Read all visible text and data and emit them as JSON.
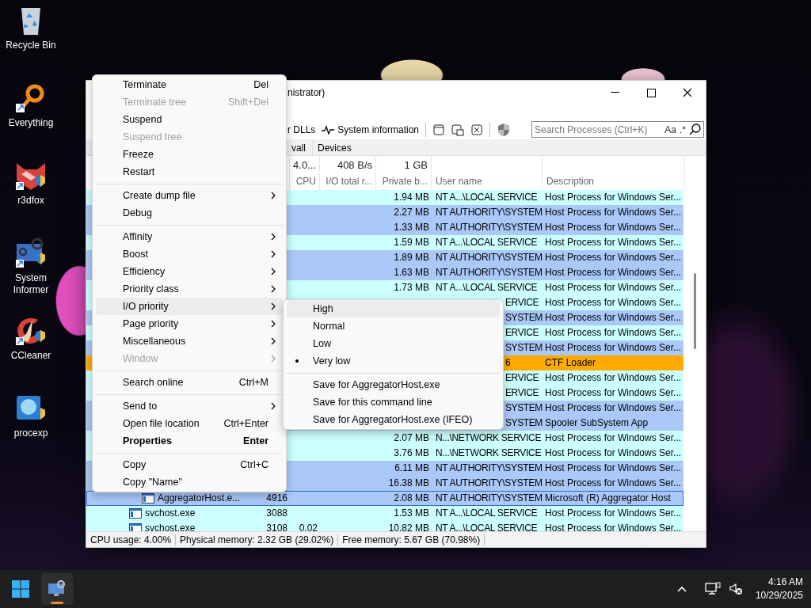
{
  "desktop_icons": [
    {
      "label": "Recycle Bin",
      "kind": "recycle"
    },
    {
      "label": "Everything",
      "kind": "search"
    },
    {
      "label": "r3dfox",
      "kind": "fox"
    },
    {
      "label": "System Informer",
      "kind": "informer"
    },
    {
      "label": "CCleaner",
      "kind": "cleaner"
    },
    {
      "label": "procexp",
      "kind": "procexp"
    }
  ],
  "window": {
    "title": "nistrator)"
  },
  "toolbar": {
    "items": [
      {
        "label": "r DLLs",
        "kind": "text"
      },
      {
        "label": "System information",
        "kind": "pulse"
      }
    ],
    "search": {
      "placeholder": "Search Processes (Ctrl+K)",
      "case_button": "Aa",
      "regex_button": ".*"
    }
  },
  "tabs": [
    {
      "label": "vall",
      "selected": false
    },
    {
      "label": "Devices",
      "selected": false
    }
  ],
  "table": {
    "totals": {
      "cpu": "4.0...",
      "io": "408 B/s",
      "private": "1 GB"
    },
    "columns": [
      "CPU",
      "I/O total r...",
      "Private b...",
      "User name",
      "Description"
    ],
    "rows": [
      {
        "private": "1.94 MB",
        "user": "NT A...\\LOCAL SERVICE",
        "covered": false,
        "description": "Host Process for Windows Ser...",
        "color": "#ccffff",
        "selected": false
      },
      {
        "private": "2.27 MB",
        "user": "NT AUTHORITY\\SYSTEM",
        "covered": false,
        "description": "Host Process for Windows Ser...",
        "color": "#aac8f8",
        "selected": false
      },
      {
        "private": "1.33 MB",
        "user": "NT AUTHORITY\\SYSTEM",
        "covered": false,
        "description": "Host Process for Windows Ser...",
        "color": "#aac8f8",
        "selected": false
      },
      {
        "private": "1.59 MB",
        "user": "NT A...\\LOCAL SERVICE",
        "covered": false,
        "description": "Host Process for Windows Ser...",
        "color": "#ccffff",
        "selected": false
      },
      {
        "private": "1.89 MB",
        "user": "NT AUTHORITY\\SYSTEM",
        "covered": false,
        "description": "Host Process for Windows Ser...",
        "color": "#aac8f8",
        "selected": false
      },
      {
        "private": "1.63 MB",
        "user": "NT AUTHORITY\\SYSTEM",
        "covered": false,
        "description": "Host Process for Windows Ser...",
        "color": "#aac8f8",
        "selected": false
      },
      {
        "private": "1.73 MB",
        "user": "NT A...\\LOCAL SERVICE",
        "covered": false,
        "description": "Host Process for Windows Ser...",
        "color": "#ccffff",
        "selected": false
      },
      {
        "user": "ERVICE",
        "covered": true,
        "description": "Host Process for Windows Ser...",
        "color": "#ccffff",
        "selected": false
      },
      {
        "user": "SYSTEM",
        "covered": true,
        "description": "Host Process for Windows Ser...",
        "color": "#aac8f8",
        "selected": false
      },
      {
        "user": "ERVICE",
        "covered": true,
        "description": "Host Process for Windows Ser...",
        "color": "#ccffff",
        "selected": false
      },
      {
        "user": "SYSTEM",
        "covered": true,
        "description": "Host Process for Windows Ser...",
        "color": "#aac8f8",
        "selected": false
      },
      {
        "user": "6",
        "covered": true,
        "description": "CTF Loader",
        "color": "#ffaa00",
        "selected": false
      },
      {
        "user": "ERVICE",
        "covered": true,
        "description": "Host Process for Windows Ser...",
        "color": "#ccffff",
        "selected": false
      },
      {
        "user": "ERVICE",
        "covered": true,
        "description": "Host Process for Windows Ser...",
        "color": "#ccffff",
        "selected": false
      },
      {
        "user": "SYSTEM",
        "covered": true,
        "description": "Host Process for Windows Ser...",
        "color": "#aac8f8",
        "selected": false
      },
      {
        "user": "SYSTEM",
        "covered": true,
        "description": "Spooler SubSystem App",
        "color": "#aac8f8",
        "selected": false
      },
      {
        "private": "2.07 MB",
        "user": "N...\\NETWORK SERVICE",
        "covered": false,
        "description": "Host Process for Windows Ser...",
        "color": "#ccffff",
        "selected": false
      },
      {
        "private": "3.76 MB",
        "user": "N...\\NETWORK SERVICE",
        "covered": false,
        "description": "Host Process for Windows Ser...",
        "color": "#ccffff",
        "selected": false
      },
      {
        "private": "6.11 MB",
        "user": "NT AUTHORITY\\SYSTEM",
        "covered": false,
        "description": "Host Process for Windows Ser...",
        "color": "#aac8f8",
        "selected": false
      },
      {
        "private": "16.38 MB",
        "user": "NT AUTHORITY\\SYSTEM",
        "covered": false,
        "description": "Host Process for Windows Ser...",
        "color": "#aac8f8",
        "selected": false,
        "children": [
          {
            "name": "AggregatorHost.e...",
            "pid": "4916",
            "private": "2.08 MB",
            "user": "NT AUTHORITY\\SYSTEM",
            "covered": false,
            "description": "Microsoft (R) Aggregator Host",
            "color": "#aac8f8",
            "selected": true
          }
        ]
      },
      {
        "name": "svchost.exe",
        "pid": "3088",
        "private": "1.53 MB",
        "user": "NT A...\\LOCAL SERVICE",
        "covered": false,
        "description": "Host Process for Windows Ser...",
        "color": "#ccffff",
        "selected": false
      },
      {
        "name": "svchost.exe",
        "pid": "3108",
        "cpu": "0.02",
        "private": "10.82 MB",
        "user": "NT A...\\LOCAL SERVICE",
        "covered": false,
        "description": "Host Process for Windows Ser...",
        "color": "#ccffff",
        "selected": false
      }
    ]
  },
  "status_bar": [
    "CPU usage: 4.00%",
    "Physical memory: 2.32 GB (29.02%)",
    "Free memory: 5.67 GB (70.98%)"
  ],
  "context_menu": [
    {
      "kind": "item",
      "label": "Terminate",
      "shortcut": "Del",
      "disabled": false,
      "highlighted": false,
      "bold": false,
      "submenu": false
    },
    {
      "kind": "item",
      "label": "Terminate tree",
      "shortcut": "Shift+Del",
      "disabled": true,
      "highlighted": false,
      "bold": false,
      "submenu": false
    },
    {
      "kind": "item",
      "label": "Suspend",
      "disabled": false,
      "highlighted": false,
      "bold": false,
      "submenu": false
    },
    {
      "kind": "item",
      "label": "Suspend tree",
      "disabled": true,
      "highlighted": false,
      "bold": false,
      "submenu": false
    },
    {
      "kind": "item",
      "label": "Freeze",
      "disabled": false,
      "highlighted": false,
      "bold": false,
      "submenu": false
    },
    {
      "kind": "item",
      "label": "Restart",
      "disabled": false,
      "highlighted": false,
      "bold": false,
      "submenu": false
    },
    {
      "kind": "separator"
    },
    {
      "kind": "item",
      "label": "Create dump file",
      "disabled": false,
      "highlighted": false,
      "bold": false,
      "submenu": true
    },
    {
      "kind": "item",
      "label": "Debug",
      "disabled": false,
      "highlighted": false,
      "bold": false,
      "submenu": false
    },
    {
      "kind": "separator"
    },
    {
      "kind": "item",
      "label": "Affinity",
      "disabled": false,
      "highlighted": false,
      "bold": false,
      "submenu": true
    },
    {
      "kind": "item",
      "label": "Boost",
      "disabled": false,
      "highlighted": false,
      "bold": false,
      "submenu": true
    },
    {
      "kind": "item",
      "label": "Efficiency",
      "disabled": false,
      "highlighted": false,
      "bold": false,
      "submenu": true
    },
    {
      "kind": "item",
      "label": "Priority class",
      "disabled": false,
      "highlighted": false,
      "bold": false,
      "submenu": true
    },
    {
      "kind": "item",
      "label": "I/O priority",
      "disabled": false,
      "highlighted": true,
      "bold": false,
      "submenu": true
    },
    {
      "kind": "item",
      "label": "Page priority",
      "disabled": false,
      "highlighted": false,
      "bold": false,
      "submenu": true
    },
    {
      "kind": "item",
      "label": "Miscellaneous",
      "disabled": false,
      "highlighted": false,
      "bold": false,
      "submenu": true
    },
    {
      "kind": "item",
      "label": "Window",
      "disabled": true,
      "highlighted": false,
      "bold": false,
      "submenu": true
    },
    {
      "kind": "separator"
    },
    {
      "kind": "item",
      "label": "Search online",
      "shortcut": "Ctrl+M",
      "disabled": false,
      "highlighted": false,
      "bold": false,
      "submenu": false
    },
    {
      "kind": "separator"
    },
    {
      "kind": "item",
      "label": "Send to",
      "disabled": false,
      "highlighted": false,
      "bold": false,
      "submenu": true
    },
    {
      "kind": "item",
      "label": "Open file location",
      "shortcut": "Ctrl+Enter",
      "disabled": false,
      "highlighted": false,
      "bold": false,
      "submenu": false
    },
    {
      "kind": "item",
      "label": "Properties",
      "shortcut": "Enter",
      "disabled": false,
      "highlighted": false,
      "bold": true,
      "submenu": false
    },
    {
      "kind": "separator"
    },
    {
      "kind": "item",
      "label": "Copy",
      "shortcut": "Ctrl+C",
      "disabled": false,
      "highlighted": false,
      "bold": false,
      "submenu": false
    },
    {
      "kind": "item",
      "label": "Copy \"Name\"",
      "disabled": false,
      "highlighted": false,
      "bold": false,
      "submenu": false
    }
  ],
  "submenu": [
    {
      "kind": "item",
      "label": "High",
      "highlighted": true,
      "selected": false
    },
    {
      "kind": "item",
      "label": "Normal",
      "highlighted": false,
      "selected": false
    },
    {
      "kind": "item",
      "label": "Low",
      "highlighted": false,
      "selected": false
    },
    {
      "kind": "item",
      "label": "Very low",
      "highlighted": false,
      "selected": true
    },
    {
      "kind": "separator"
    },
    {
      "kind": "item",
      "label": "Save for AggregatorHost.exe",
      "highlighted": false,
      "selected": false
    },
    {
      "kind": "item",
      "label": "Save for this command line",
      "highlighted": false,
      "selected": false
    },
    {
      "kind": "item",
      "label": "Save for AggregatorHost.exe (IFEO)",
      "highlighted": false,
      "selected": false
    }
  ],
  "taskbar": {
    "clock": {
      "time": "4:16 AM",
      "date": "10/29/2025"
    }
  }
}
